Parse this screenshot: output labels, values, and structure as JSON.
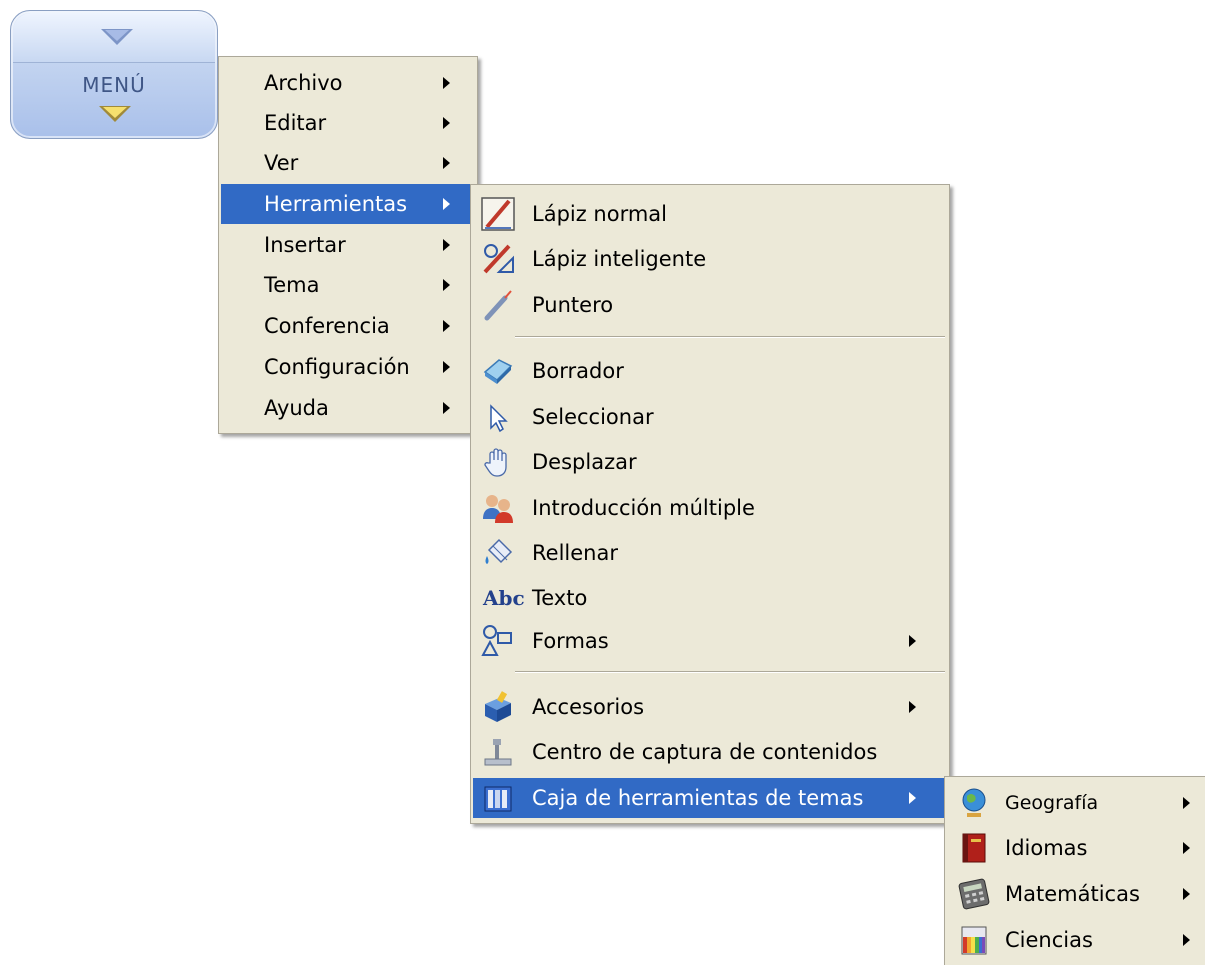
{
  "menu_button": {
    "label": "MENÚ"
  },
  "main_menu": {
    "items": [
      {
        "label": "Archivo",
        "submenu": true
      },
      {
        "label": "Editar",
        "submenu": true
      },
      {
        "label": "Ver",
        "submenu": true
      },
      {
        "label": "Herramientas",
        "submenu": true,
        "selected": true
      },
      {
        "label": "Insertar",
        "submenu": true
      },
      {
        "label": "Tema",
        "submenu": true
      },
      {
        "label": "Conferencia",
        "submenu": true
      },
      {
        "label": "Configuración",
        "submenu": true
      },
      {
        "label": "Ayuda",
        "submenu": true
      }
    ]
  },
  "tools_menu": {
    "items": [
      {
        "label": "Lápiz normal",
        "icon": "pencil-icon"
      },
      {
        "label": "Lápiz inteligente",
        "icon": "smart-pencil-icon"
      },
      {
        "label": "Puntero",
        "icon": "pointer-pen-icon"
      },
      {
        "label": "Borrador",
        "icon": "eraser-icon"
      },
      {
        "label": "Seleccionar",
        "icon": "select-arrow-icon"
      },
      {
        "label": "Desplazar",
        "icon": "hand-icon"
      },
      {
        "label": "Introducción múltiple",
        "icon": "multi-user-icon"
      },
      {
        "label": "Rellenar",
        "icon": "fill-bucket-icon"
      },
      {
        "label": "Texto",
        "icon": "text-icon",
        "icon_text": "Abc"
      },
      {
        "label": "Formas",
        "icon": "shapes-icon",
        "submenu": true
      },
      {
        "label": "Accesorios",
        "icon": "accessories-icon",
        "submenu": true
      },
      {
        "label": "Centro de captura de contenidos",
        "icon": "capture-center-icon"
      },
      {
        "label": "Caja de herramientas de temas",
        "icon": "toolbox-icon",
        "submenu": true,
        "selected": true
      }
    ]
  },
  "subjects_menu": {
    "items": [
      {
        "label": "Geografía",
        "icon": "globe-icon",
        "submenu": true
      },
      {
        "label": "Idiomas",
        "icon": "book-icon",
        "submenu": true
      },
      {
        "label": "Matemáticas",
        "icon": "calculator-icon",
        "submenu": true
      },
      {
        "label": "Ciencias",
        "icon": "beaker-icon",
        "submenu": true
      }
    ]
  },
  "colors": {
    "menu_bg": "#ece9d8",
    "highlight": "#316ac5",
    "border": "#aca899"
  }
}
